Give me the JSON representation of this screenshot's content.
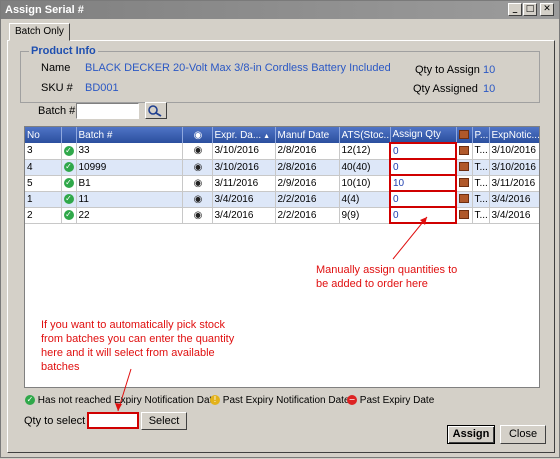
{
  "window": {
    "title": "Assign Serial #",
    "min": "_",
    "max": "□",
    "close": "✕"
  },
  "tab": {
    "label": "Batch Only"
  },
  "product": {
    "group_title": "Product Info",
    "name_label": "Name",
    "name_value": "BLACK DECKER 20-Volt Max 3/8-in Cordless Battery Included",
    "sku_label": "SKU #",
    "sku_value": "BD001",
    "qty_assign_label": "Qty to Assign",
    "qty_assign_value": "10",
    "qty_assigned_label": "Qty Assigned",
    "qty_assigned_value": "10"
  },
  "batch_search": {
    "label": "Batch #",
    "value": ""
  },
  "grid": {
    "columns": [
      "No",
      "",
      "Batch #",
      "",
      "Expr. Da...",
      "Manuf Date",
      "ATS(Stoc...",
      "Assign Qty",
      "",
      "P...",
      "ExpNotic..."
    ],
    "rows": [
      {
        "no": "3",
        "batch": "33",
        "expr": "3/10/2016",
        "manuf": "2/8/2016",
        "ats": "12(12)",
        "qty": "0",
        "p": "T...",
        "expnotice": "3/10/2016"
      },
      {
        "no": "4",
        "batch": "10999",
        "expr": "3/10/2016",
        "manuf": "2/8/2016",
        "ats": "40(40)",
        "qty": "0",
        "p": "T...",
        "expnotice": "3/10/2016"
      },
      {
        "no": "5",
        "batch": "B1",
        "expr": "3/11/2016",
        "manuf": "2/9/2016",
        "ats": "10(10)",
        "qty": "10",
        "p": "T...",
        "expnotice": "3/11/2016"
      },
      {
        "no": "1",
        "batch": "11",
        "expr": "3/4/2016",
        "manuf": "2/2/2016",
        "ats": "4(4)",
        "qty": "0",
        "p": "T...",
        "expnotice": "3/4/2016"
      },
      {
        "no": "2",
        "batch": "22",
        "expr": "3/4/2016",
        "manuf": "2/2/2016",
        "ats": "9(9)",
        "qty": "0",
        "p": "T...",
        "expnotice": "3/4/2016"
      }
    ]
  },
  "annotations": {
    "manual_line1": "Manually assign quantities to",
    "manual_line2": "be added to order here",
    "auto_line1": "If you want to automatically pick stock",
    "auto_line2": "from batches you can enter the quantity",
    "auto_line3": "here and it will select from available",
    "auto_line4": "batches"
  },
  "legend": {
    "green": "Has not reached Expiry Notification Date",
    "yellow": "Past Expiry Notification Date",
    "red": "Past Expiry Date"
  },
  "bottom": {
    "qty_select_label": "Qty to select",
    "qty_select_value": "",
    "select_button": "Select",
    "assign_button": "Assign",
    "close_button": "Close"
  },
  "colors": {
    "header": "#2b4f9e",
    "annotation": "#e01010",
    "accent": "#2b58c4"
  }
}
